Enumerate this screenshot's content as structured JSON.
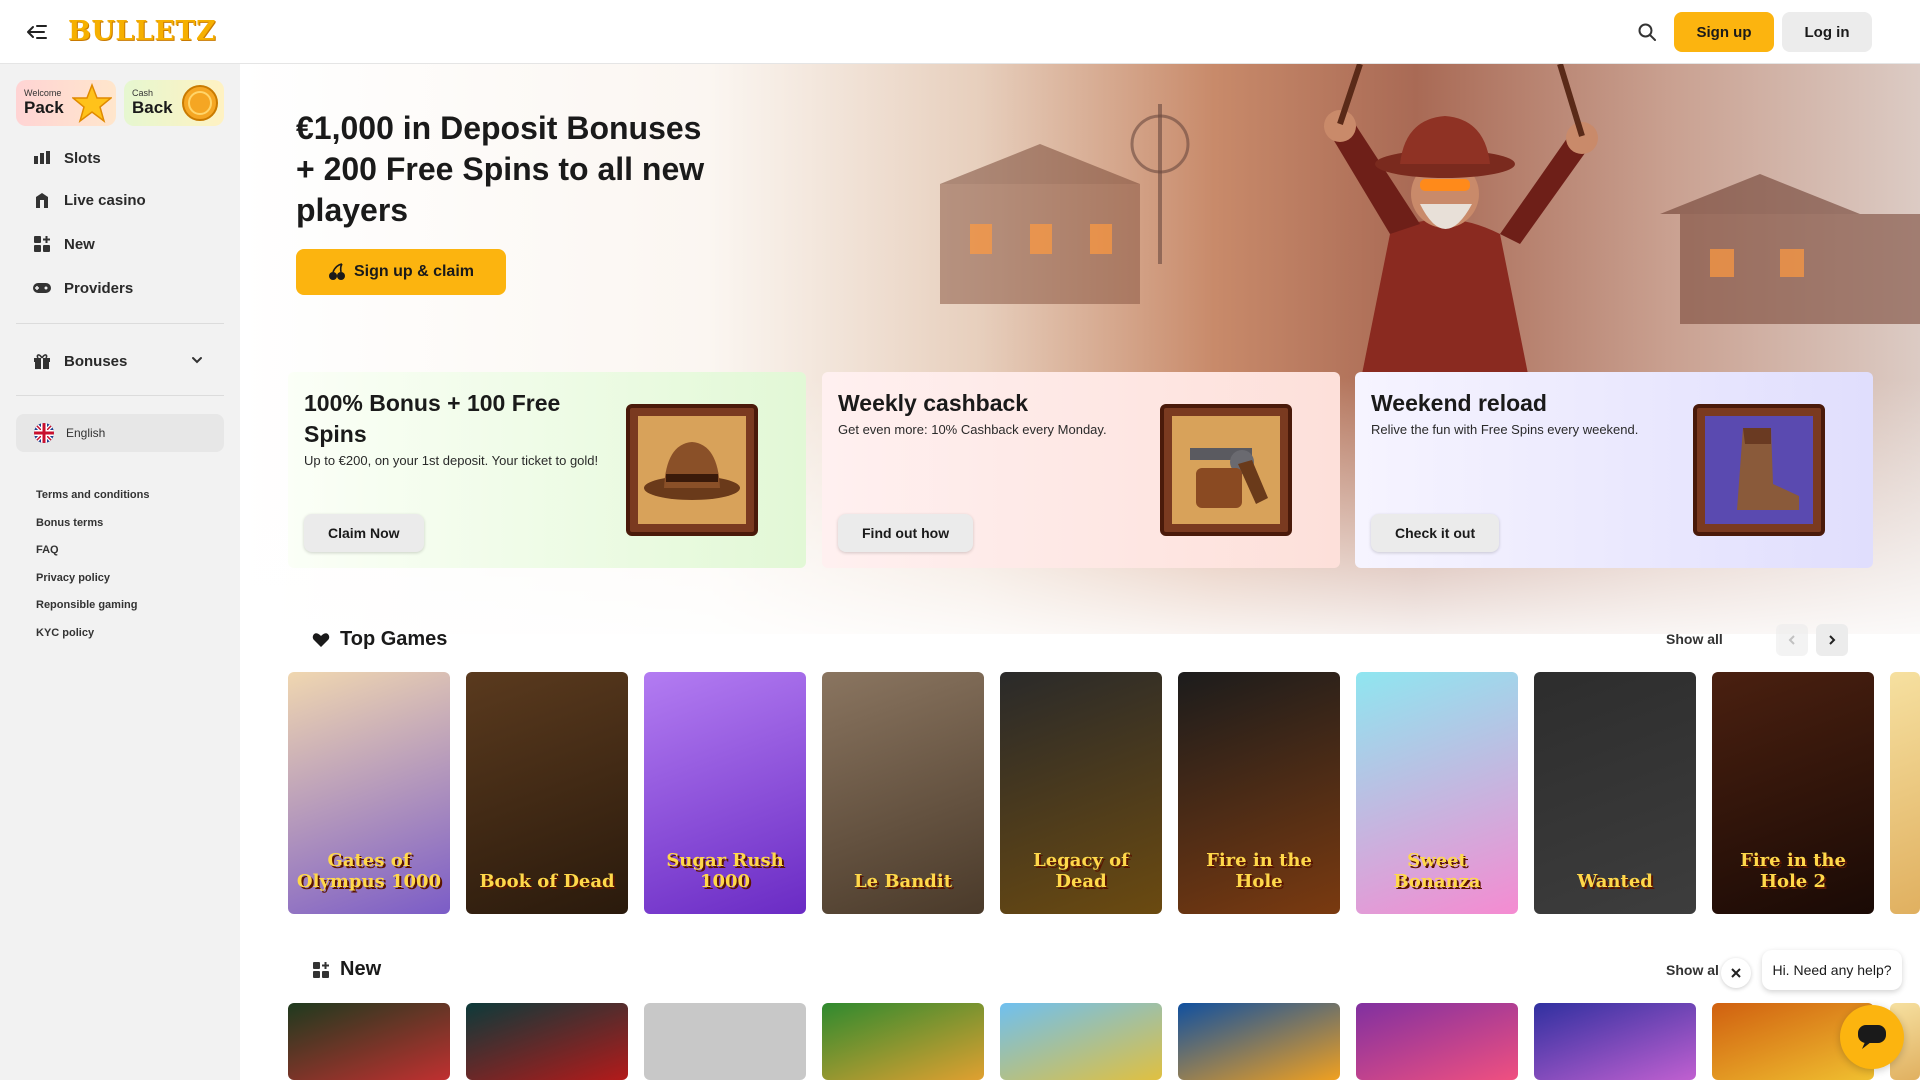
{
  "brand": {
    "logo_text": "BULLETZ",
    "accent": "#fcb40f"
  },
  "header": {
    "menu_icon": "menu-collapse-icon",
    "search_icon": "search-icon",
    "signup_label": "Sign up",
    "login_label": "Log in"
  },
  "sidebar": {
    "promos": [
      {
        "small": "Welcome",
        "big": "Pack",
        "icon": "star-icon"
      },
      {
        "small": "Cash",
        "big": "Back",
        "icon": "coin-icon"
      }
    ],
    "nav": [
      {
        "label": "Slots",
        "icon": "slots-icon"
      },
      {
        "label": "Live casino",
        "icon": "live-casino-icon"
      },
      {
        "label": "New",
        "icon": "new-grid-icon"
      },
      {
        "label": "Providers",
        "icon": "gamepad-icon"
      }
    ],
    "bonuses": {
      "label": "Bonuses",
      "icon": "gift-icon"
    },
    "language": {
      "label": "English",
      "icon": "uk-flag-icon"
    },
    "footer_links": [
      "Terms and conditions",
      "Bonus terms",
      "FAQ",
      "Privacy policy",
      "Reponsible gaming",
      "KYC policy"
    ]
  },
  "hero": {
    "title": "€1,000 in Deposit Bonuses + 200 Free Spins to all new players",
    "cta_label": "Sign up & claim"
  },
  "promo_cards": [
    {
      "title": "100% Bonus + 100 Free Spins",
      "desc": "Up to €200, on your 1st deposit. Your ticket to gold!",
      "button": "Claim Now",
      "art": "cowboy-hat-icon"
    },
    {
      "title": "Weekly cashback",
      "desc": "Get even more: 10% Cashback every Monday.",
      "button": "Find out how",
      "art": "revolver-icon"
    },
    {
      "title": "Weekend reload",
      "desc": "Relive the fun with Free Spins every weekend.",
      "button": "Check it out",
      "art": "boot-icon"
    }
  ],
  "top_games": {
    "title": "Top Games",
    "icon": "heart-icon",
    "show_all": "Show all",
    "games": [
      {
        "name": "Gates of Olympus 1000",
        "colors": [
          "#f0d7b0",
          "#7b5cc7"
        ]
      },
      {
        "name": "Book of Dead",
        "colors": [
          "#5a3a1e",
          "#2a1a0c"
        ]
      },
      {
        "name": "Sugar Rush 1000",
        "colors": [
          "#b37cf2",
          "#6a2bc4"
        ]
      },
      {
        "name": "Le Bandit",
        "colors": [
          "#8a7560",
          "#4a3a2a"
        ]
      },
      {
        "name": "Legacy of Dead",
        "colors": [
          "#2a2a2a",
          "#6b4a10"
        ]
      },
      {
        "name": "Fire in the Hole",
        "colors": [
          "#1c1c1c",
          "#7a3a10"
        ]
      },
      {
        "name": "Sweet Bonanza",
        "colors": [
          "#8fe6f0",
          "#f58bd1"
        ]
      },
      {
        "name": "Wanted",
        "colors": [
          "#2d2d2d",
          "#3d3d3d"
        ]
      },
      {
        "name": "Fire in the Hole 2",
        "colors": [
          "#4a2010",
          "#1a0a05"
        ]
      }
    ]
  },
  "new_games": {
    "title": "New",
    "icon": "new-grid-icon",
    "show_all": "Show al",
    "games": [
      {
        "colors": [
          "#1e3a1e",
          "#c03030"
        ]
      },
      {
        "colors": [
          "#0c3a3a",
          "#b31a1a"
        ]
      },
      {
        "colors": [
          "#c8c8c8",
          "#c8c8c8"
        ]
      },
      {
        "colors": [
          "#2f8a2f",
          "#e0a030"
        ]
      },
      {
        "colors": [
          "#6fc0f0",
          "#e0c040"
        ]
      },
      {
        "colors": [
          "#1050a0",
          "#f0a020"
        ]
      },
      {
        "colors": [
          "#8030a0",
          "#f05080"
        ]
      },
      {
        "colors": [
          "#3030a0",
          "#c060d0"
        ]
      },
      {
        "colors": [
          "#d06010",
          "#f0c030"
        ]
      }
    ]
  },
  "chat": {
    "bubble": "Hi. Need any help?",
    "close_icon": "close-icon",
    "chat_icon": "chat-icon"
  }
}
